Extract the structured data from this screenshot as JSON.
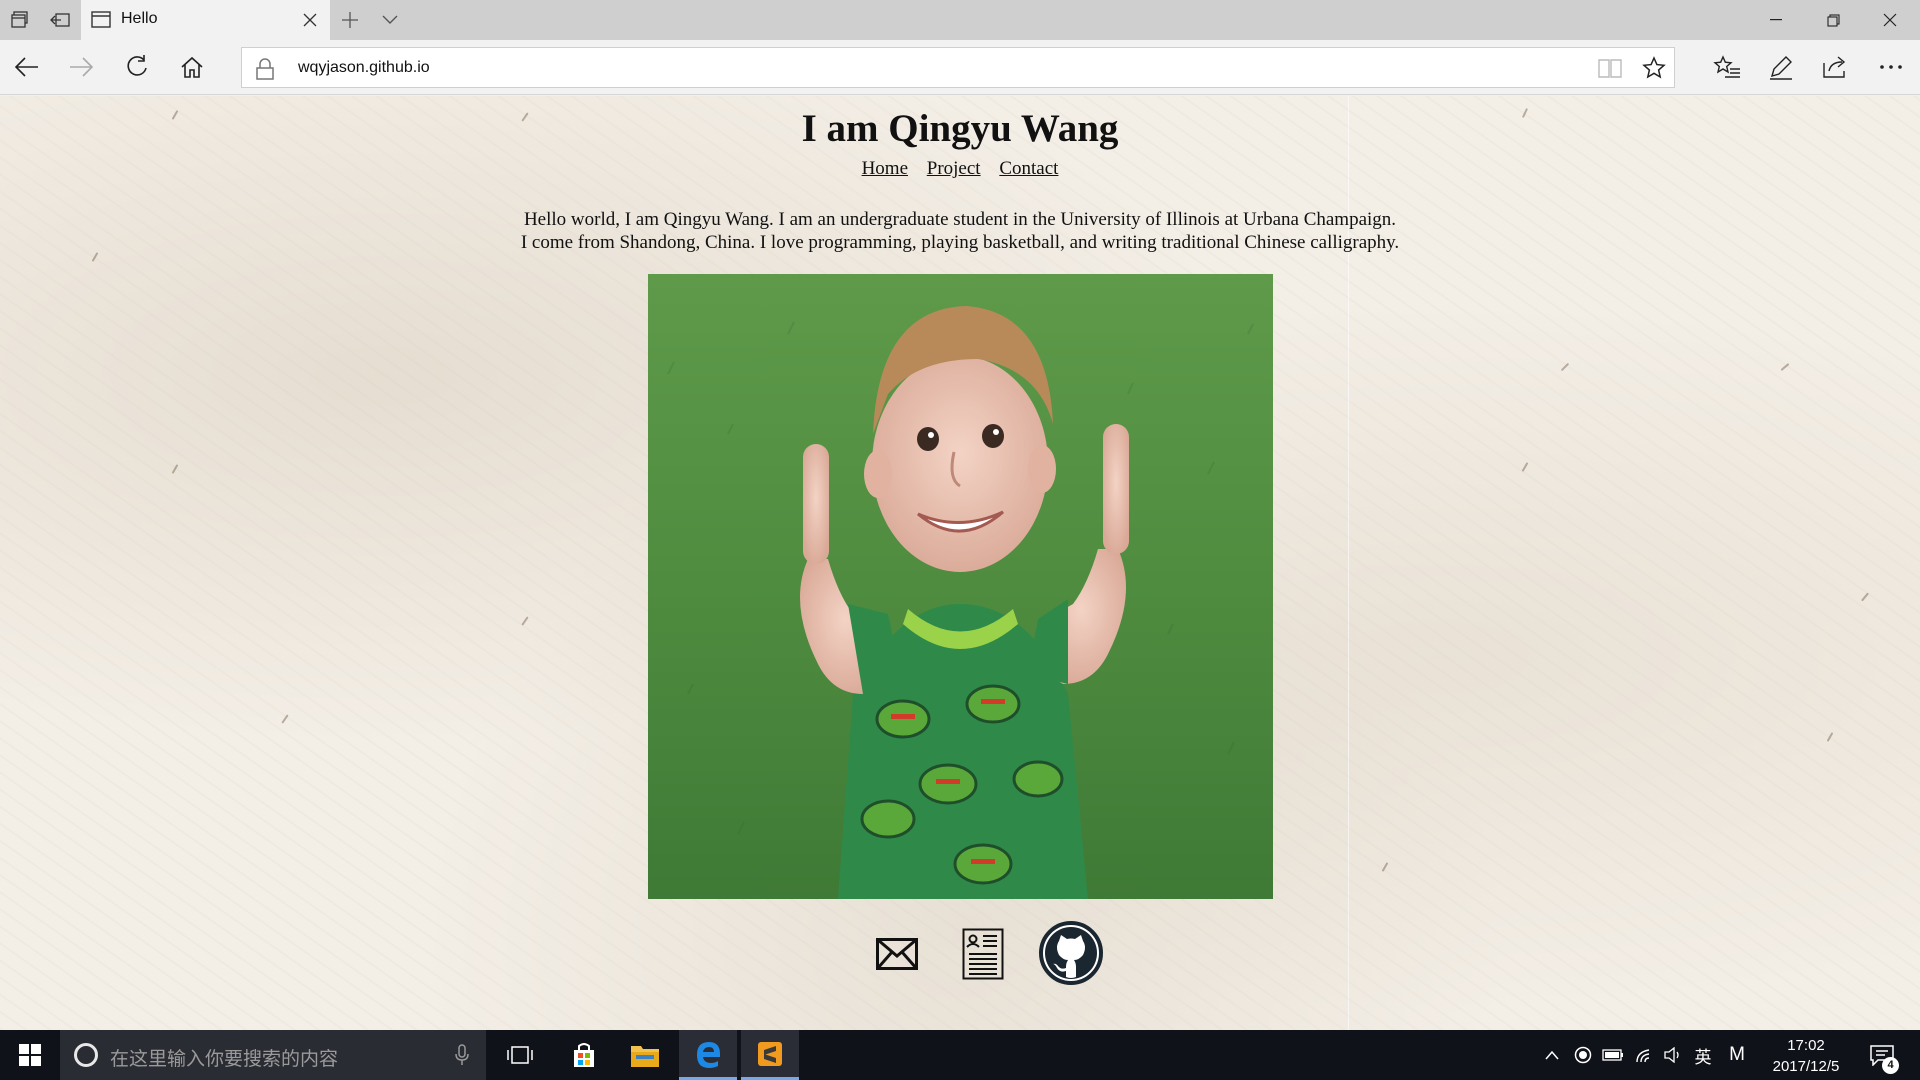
{
  "browser": {
    "tab": {
      "title": "Hello"
    },
    "address": {
      "url": "wqyjason.github.io"
    },
    "icons": {
      "tab_manager": "tab-manager-icon",
      "set_aside": "set-aside-tabs-icon",
      "new_tab": "plus-icon",
      "tab_list": "chevron-down-icon",
      "back": "back-arrow-icon",
      "forward": "forward-arrow-icon",
      "refresh": "refresh-icon",
      "home": "home-icon",
      "reading_view": "reading-view-icon",
      "favorite": "star-icon",
      "hub": "favorites-hub-icon",
      "notes": "pen-icon",
      "share": "share-icon",
      "more": "more-dots-icon"
    }
  },
  "page": {
    "title": "I am Qingyu Wang",
    "nav": [
      "Home",
      "Project",
      "Contact"
    ],
    "intro": [
      "Hello world, I am Qingyu Wang. I am an undergraduate student in the University of Illinois at Urbana Champaign.",
      "I come from Shandong, China. I love programming, playing basketball, and writing traditional Chinese calligraphy."
    ],
    "social": [
      "email-icon",
      "resume-icon",
      "github-icon"
    ]
  },
  "taskbar": {
    "search_placeholder": "在这里输入你要搜索的内容",
    "apps": [
      "task-view-icon",
      "store-icon",
      "file-explorer-icon",
      "edge-icon",
      "sublime-text-icon"
    ],
    "ime": "英",
    "ime_mode": "M",
    "time": "17:02",
    "date": "2017/12/5",
    "notifications": "4"
  },
  "colors": {
    "tabbar": "#cfcfcf",
    "toolbar": "#f2f2f2",
    "paper": "#f3eee6",
    "taskbar": "#10121a",
    "edge_blue": "#0078d7",
    "accent_underline": "#76a9e8"
  }
}
